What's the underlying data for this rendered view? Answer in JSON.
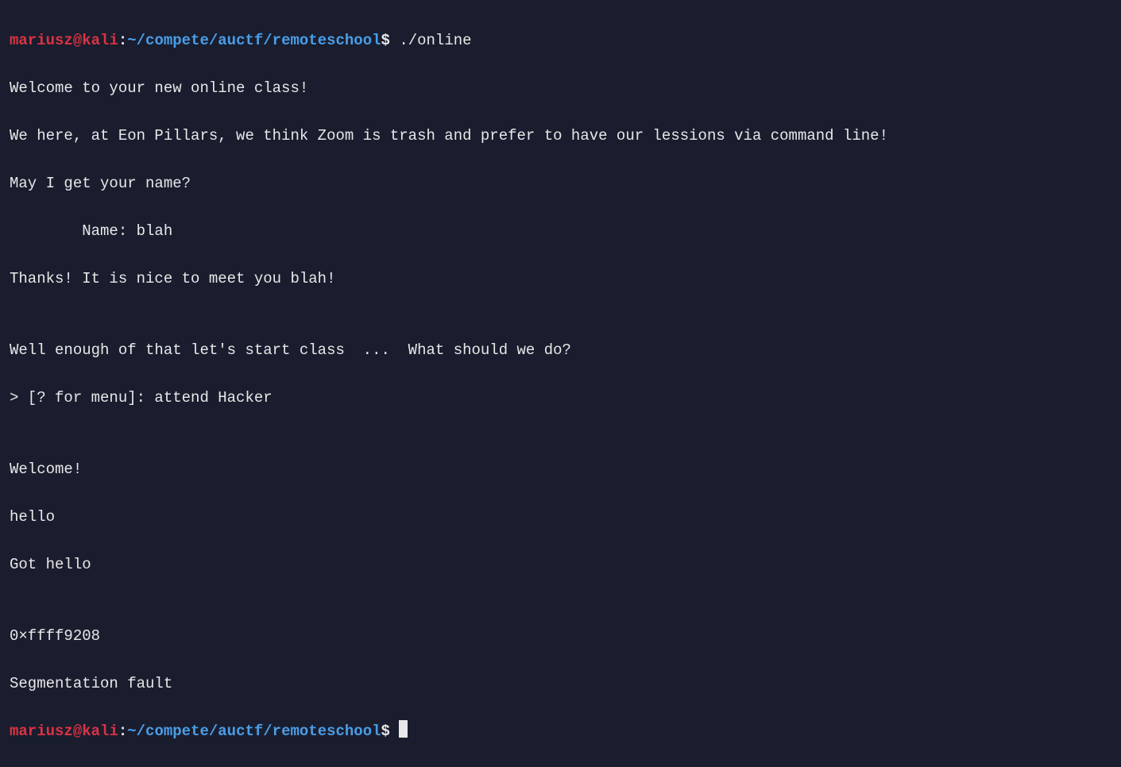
{
  "prompt1": {
    "user": "mariusz",
    "at": "@",
    "host": "kali",
    "colon": ":",
    "path": "~/compete/auctf/remoteschool",
    "dollar": "$",
    "command": " ./online"
  },
  "output": {
    "l1": "Welcome to your new online class!",
    "l2": "We here, at Eon Pillars, we think Zoom is trash and prefer to have our lessions via command line!",
    "l3": "May I get your name?",
    "l4": "        Name: blah",
    "l5": "Thanks! It is nice to meet you blah!",
    "l6": "",
    "l7": "Well enough of that let's start class  ...  What should we do?",
    "l8": "> [? for menu]: attend Hacker",
    "l9": "",
    "l10": "Welcome!",
    "l11": "hello",
    "l12": "Got hello",
    "l13": "",
    "l14": "0×ffff9208",
    "l15": "Segmentation fault"
  },
  "prompt2": {
    "user": "mariusz",
    "at": "@",
    "host": "kali",
    "colon": ":",
    "path": "~/compete/auctf/remoteschool",
    "dollar": "$",
    "command": " "
  }
}
